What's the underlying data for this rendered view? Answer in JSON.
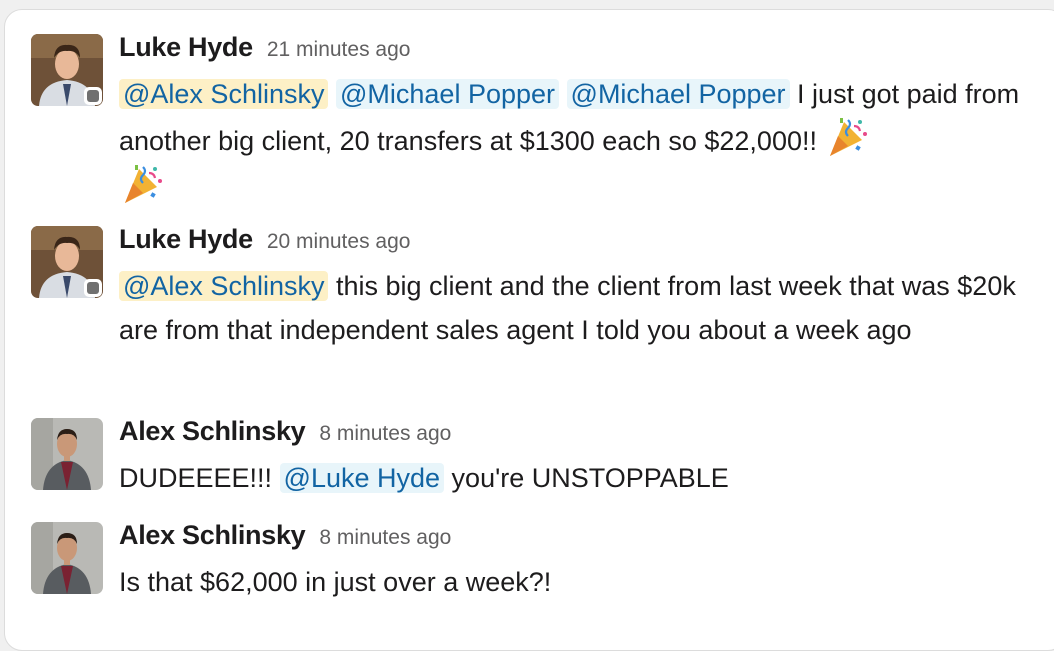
{
  "messages": [
    {
      "author": "Luke Hyde",
      "time": "21 minutes ago",
      "mentions": [
        "@Alex Schlinsky",
        "@Michael Popper",
        "@Michael Popper"
      ],
      "text_1": " I just got paid from another big client, 20 transfers at $1300 each so $22,000!! ",
      "emoji": [
        "party-popper",
        "party-popper"
      ]
    },
    {
      "author": "Luke Hyde",
      "time": "20 minutes ago",
      "mentions": [
        "@Alex Schlinsky"
      ],
      "text_1": " this big client and the client from last week that was $20k are from that independent sales agent I told you about a week ago"
    },
    {
      "author": "Alex Schlinsky",
      "time": "8 minutes ago",
      "text_0": "DUDEEEE!!! ",
      "mentions": [
        "@Luke Hyde"
      ],
      "text_1": " you're UNSTOPPABLE"
    },
    {
      "author": "Alex Schlinsky",
      "time": "8 minutes ago",
      "text_0": "Is that $62,000 in just over a week?!"
    }
  ],
  "colors": {
    "mention_bg": "#e8f5fa",
    "mention_text": "#1264a3",
    "self_mention_bg": "#fdf0c6",
    "presence_away": "#707070"
  }
}
